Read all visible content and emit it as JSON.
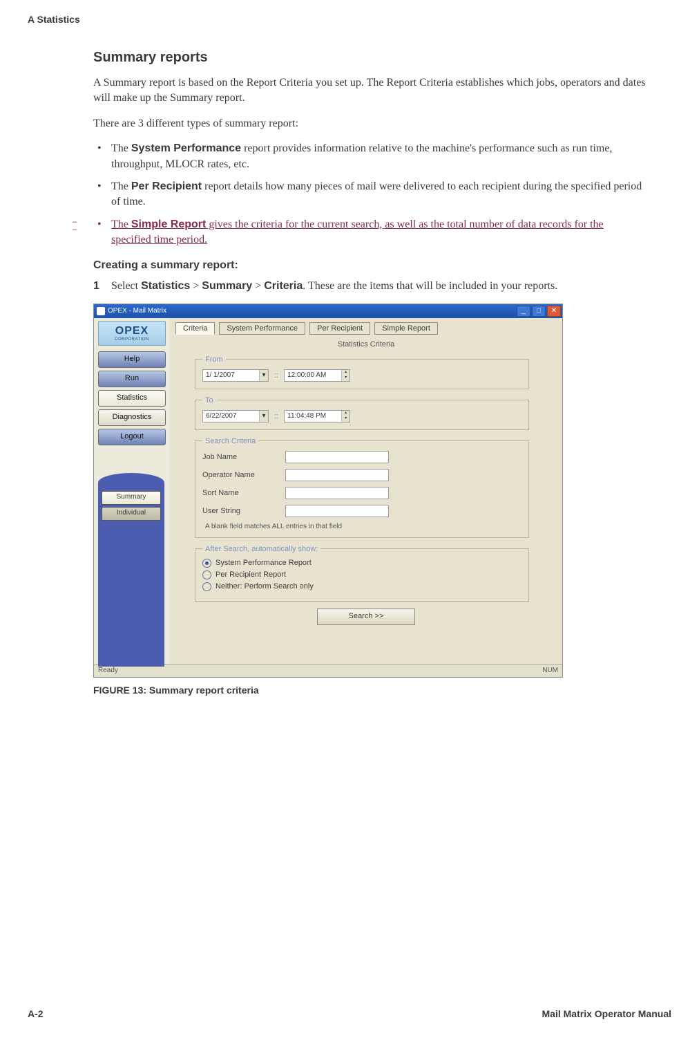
{
  "header": {
    "section": "A  Statistics"
  },
  "title": "Summary reports",
  "para1": "A Summary report is based on the Report Criteria you set up. The Report Criteria establishes which jobs, operators and dates will make up the Summary report.",
  "para2": "There are 3 different types of summary report:",
  "bullets": {
    "b1_pre": "The ",
    "b1_bold": "System Performance",
    "b1_post": " report provides information relative to the machine's performance such as run time, throughput, MLOCR rates, etc.",
    "b2_pre": "The ",
    "b2_bold": "Per Recipient",
    "b2_post": " report details how many pieces of mail were delivered to each recipient during the specified period of time.",
    "b3_pre": "The ",
    "b3_bold": "Simple Report",
    "b3_post": " gives the criteria for the current search, as well as the total number of data records for the specified time period."
  },
  "subhead": "Creating a summary report:",
  "step1": {
    "num": "1",
    "pre": "Select ",
    "s1": "Statistics",
    "gt1": " > ",
    "s2": "Summary",
    "gt2": " > ",
    "s3": "Criteria",
    "post": ". These are the items that will be included in your reports."
  },
  "screenshot": {
    "titlebar": "OPEX - Mail Matrix",
    "logo_main": "OPEX",
    "logo_sub": "CORPORATION",
    "side": {
      "help": "Help",
      "run": "Run",
      "statistics": "Statistics",
      "diagnostics": "Diagnostics",
      "logout": "Logout",
      "summary": "Summary",
      "individual": "Individual"
    },
    "tabs": {
      "criteria": "Criteria",
      "sysperf": "System Performance",
      "perrecip": "Per Recipient",
      "simple": "Simple Report"
    },
    "panel_title": "Statistics Criteria",
    "from": {
      "legend": "From",
      "date": "1/ 1/2007",
      "time": "12:00:00 AM"
    },
    "to": {
      "legend": "To",
      "date": "6/22/2007",
      "time": "11:04:48 PM"
    },
    "search": {
      "legend": "Search Criteria",
      "job": "Job Name",
      "op": "Operator Name",
      "sort": "Sort Name",
      "user": "User String",
      "hint": "A blank field matches ALL entries in that field"
    },
    "after": {
      "legend": "After Search, automatically show:",
      "r1": "System Performance Report",
      "r2": "Per Recipient Report",
      "r3": "Neither: Perform Search only"
    },
    "searchbtn": "Search  >>",
    "status_left": "Ready",
    "status_right": "NUM"
  },
  "figcaption": "FIGURE 13: Summary report criteria",
  "footer": {
    "left": "A-2",
    "right": "Mail Matrix Operator Manual"
  }
}
